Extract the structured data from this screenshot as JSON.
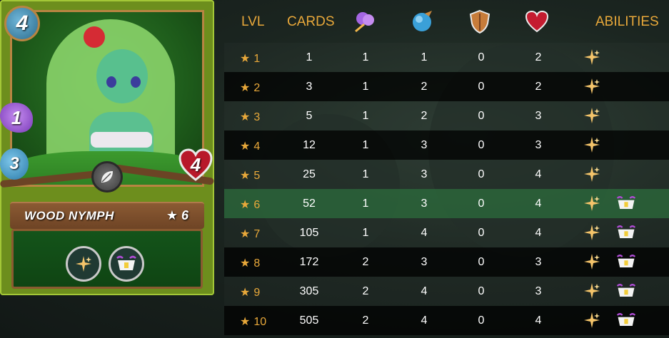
{
  "card": {
    "name": "WOOD NYMPH",
    "level_label": "★ 6",
    "stats": {
      "mana": "4",
      "attack": "1",
      "speed": "3",
      "health": "4"
    },
    "splinter_icon": "leaf-icon",
    "abilities": [
      "heal-icon",
      "tank-heal-icon"
    ]
  },
  "table": {
    "headers": {
      "lvl": "LVL",
      "cards": "CARDS",
      "abilities": "ABILITIES"
    },
    "header_icons": [
      "attack-icon",
      "speed-icon",
      "armor-icon",
      "health-icon"
    ],
    "highlight_level": 6,
    "rows": [
      {
        "lvl": "1",
        "cards": "1",
        "atk": "1",
        "spd": "1",
        "arm": "0",
        "hp": "2",
        "abilities": [
          "heal-icon"
        ]
      },
      {
        "lvl": "2",
        "cards": "3",
        "atk": "1",
        "spd": "2",
        "arm": "0",
        "hp": "2",
        "abilities": [
          "heal-icon"
        ]
      },
      {
        "lvl": "3",
        "cards": "5",
        "atk": "1",
        "spd": "2",
        "arm": "0",
        "hp": "3",
        "abilities": [
          "heal-icon"
        ]
      },
      {
        "lvl": "4",
        "cards": "12",
        "atk": "1",
        "spd": "3",
        "arm": "0",
        "hp": "3",
        "abilities": [
          "heal-icon"
        ]
      },
      {
        "lvl": "5",
        "cards": "25",
        "atk": "1",
        "spd": "3",
        "arm": "0",
        "hp": "4",
        "abilities": [
          "heal-icon"
        ]
      },
      {
        "lvl": "6",
        "cards": "52",
        "atk": "1",
        "spd": "3",
        "arm": "0",
        "hp": "4",
        "abilities": [
          "heal-icon",
          "tank-heal-icon"
        ]
      },
      {
        "lvl": "7",
        "cards": "105",
        "atk": "1",
        "spd": "4",
        "arm": "0",
        "hp": "4",
        "abilities": [
          "heal-icon",
          "tank-heal-icon"
        ]
      },
      {
        "lvl": "8",
        "cards": "172",
        "atk": "2",
        "spd": "3",
        "arm": "0",
        "hp": "3",
        "abilities": [
          "heal-icon",
          "tank-heal-icon"
        ]
      },
      {
        "lvl": "9",
        "cards": "305",
        "atk": "2",
        "spd": "4",
        "arm": "0",
        "hp": "3",
        "abilities": [
          "heal-icon",
          "tank-heal-icon"
        ]
      },
      {
        "lvl": "10",
        "cards": "505",
        "atk": "2",
        "spd": "4",
        "arm": "0",
        "hp": "4",
        "abilities": [
          "heal-icon",
          "tank-heal-icon"
        ]
      }
    ]
  }
}
